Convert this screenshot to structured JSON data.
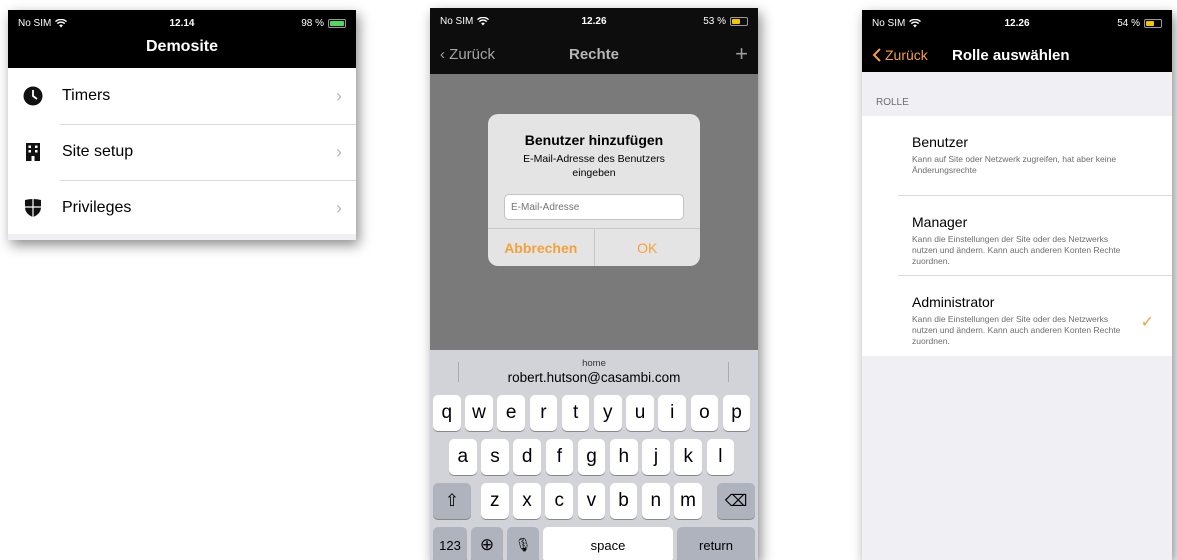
{
  "screen1": {
    "status": {
      "carrier": "No SIM",
      "time": "12.14",
      "battery": "98 %",
      "battery_level": 0.98
    },
    "title": "Demosite",
    "items": [
      {
        "label": "Timers",
        "icon": "clock-icon"
      },
      {
        "label": "Site setup",
        "icon": "building-icon"
      },
      {
        "label": "Privileges",
        "icon": "shield-icon"
      }
    ]
  },
  "screen2": {
    "status": {
      "carrier": "No SIM",
      "time": "12.26",
      "battery": "53 %",
      "battery_level": 0.53
    },
    "nav": {
      "back": "Zurück",
      "title": "Rechte",
      "add": "+"
    },
    "alert": {
      "title": "Benutzer hinzufügen",
      "message": "E-Mail-Adresse des Benutzers eingeben",
      "placeholder": "E-Mail-Adresse",
      "cancel": "Abbrechen",
      "ok": "OK"
    },
    "keyboard": {
      "suggestion_label": "home",
      "suggestion_value": "robert.hutson@casambi.com",
      "row1": [
        "q",
        "w",
        "e",
        "r",
        "t",
        "y",
        "u",
        "i",
        "o",
        "p"
      ],
      "row2": [
        "a",
        "s",
        "d",
        "f",
        "g",
        "h",
        "j",
        "k",
        "l"
      ],
      "row3": [
        "z",
        "x",
        "c",
        "v",
        "b",
        "n",
        "m"
      ],
      "numbers": "123",
      "space": "space",
      "return": "return"
    }
  },
  "screen3": {
    "status": {
      "carrier": "No SIM",
      "time": "12.26",
      "battery": "54 %",
      "battery_level": 0.54
    },
    "nav": {
      "back": "Zurück",
      "title": "Rolle auswählen"
    },
    "section": "ROLLE",
    "roles": [
      {
        "name": "Benutzer",
        "desc": "Kann auf Site oder Netzwerk zugreifen, hat aber keine Änderungsrechte",
        "selected": false
      },
      {
        "name": "Manager",
        "desc": "Kann die Einstellungen der Site oder des Netzwerks nutzen und ändern. Kann auch anderen Konten Rechte zuordnen.",
        "selected": false
      },
      {
        "name": "Administrator",
        "desc": "Kann die Einstellungen der Site oder des Netzwerks nutzen und ändern. Kann auch anderen Konten Rechte zuordnen.",
        "selected": true
      }
    ]
  },
  "colors": {
    "accent": "#f5a13a",
    "header": "#000000",
    "battery_green": "#4cd964"
  }
}
